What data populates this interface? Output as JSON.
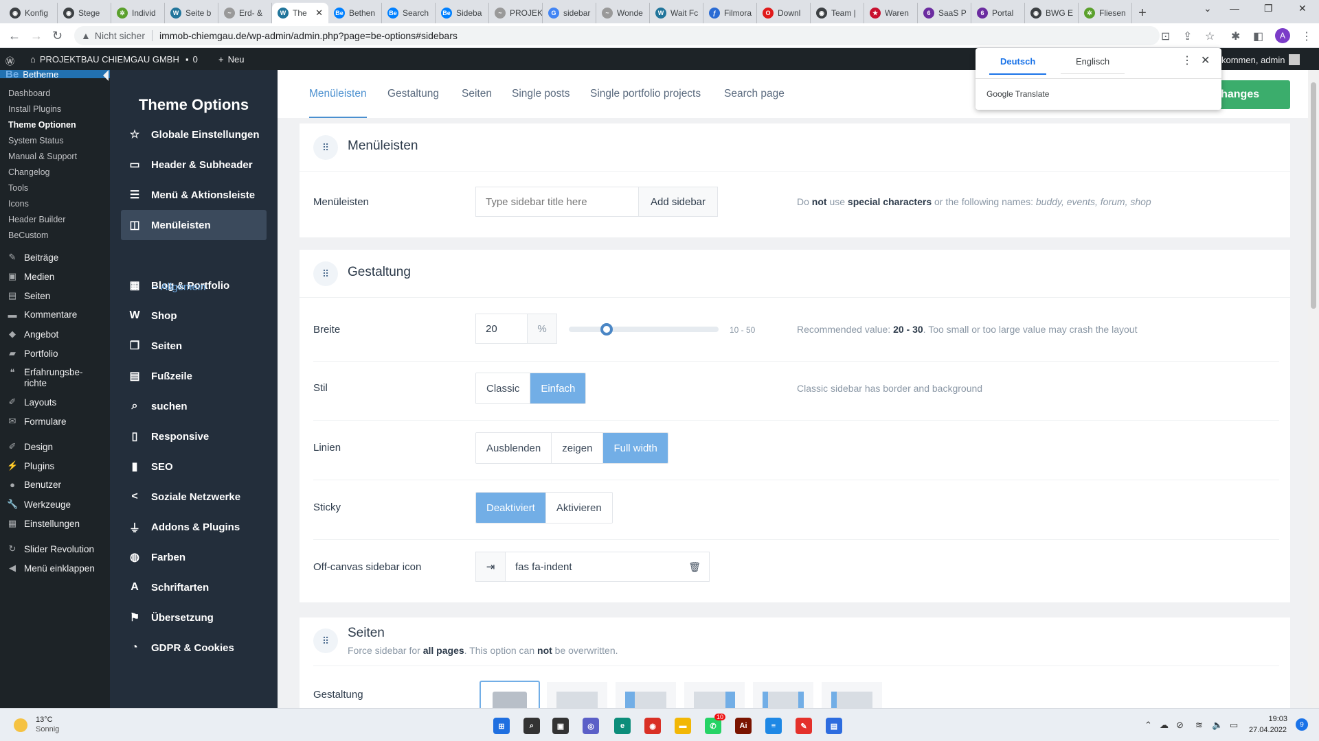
{
  "browser": {
    "tabs": [
      {
        "label": "Konfig",
        "icon": "chrome-icon"
      },
      {
        "label": "Stege",
        "icon": "chrome-icon"
      },
      {
        "label": "Individ",
        "icon": "leaf-icon"
      },
      {
        "label": "Seite b",
        "icon": "wordpress-icon"
      },
      {
        "label": "Erd- &",
        "icon": "wave-icon"
      },
      {
        "label": "The",
        "icon": "wordpress-icon",
        "active": true
      },
      {
        "label": "Bethen",
        "icon": "be-icon"
      },
      {
        "label": "Search",
        "icon": "be-icon"
      },
      {
        "label": "Sideba",
        "icon": "be-icon"
      },
      {
        "label": "PROJEK",
        "icon": "wave-icon"
      },
      {
        "label": "sidebar",
        "icon": "google-icon"
      },
      {
        "label": "Wonde",
        "icon": "wave-icon"
      },
      {
        "label": "Wait Fc",
        "icon": "wordpress-icon"
      },
      {
        "label": "Filmora",
        "icon": "filmora-icon"
      },
      {
        "label": "Downl",
        "icon": "opera-icon"
      },
      {
        "label": "Team |",
        "icon": "chrome-icon"
      },
      {
        "label": "Waren",
        "icon": "star-icon"
      },
      {
        "label": "SaaS P",
        "icon": "six-icon"
      },
      {
        "label": "Portal",
        "icon": "six-icon"
      },
      {
        "label": "BWG E",
        "icon": "chrome-icon"
      },
      {
        "label": "Fliesen",
        "icon": "leaf-icon"
      }
    ],
    "security_warning": "Nicht sicher",
    "url": "immob-chiemgau.de/wp-admin/admin.php?page=be-options#sidebars",
    "avatar_letter": "A"
  },
  "admin_bar": {
    "site_name": "PROJEKTBAU CHIEMGAU GMBH",
    "comments_count": "0",
    "new_label": "Neu",
    "greeting": "kommen, admin"
  },
  "translate_popup": {
    "lang_active": "Deutsch",
    "lang_other": "Englisch",
    "brand": "Google Translate"
  },
  "wp_menu": {
    "betheme_label": "Betheme",
    "submenu": [
      "Dashboard",
      "Install Plugins",
      "Theme Optionen",
      "System Status",
      "Manual & Support",
      "Changelog",
      "Tools",
      "Icons",
      "Header Builder",
      "BeCustom"
    ],
    "items": [
      {
        "label": "Beiträge",
        "icon": "pin-icon"
      },
      {
        "label": "Medien",
        "icon": "media-icon"
      },
      {
        "label": "Seiten",
        "icon": "pages-icon"
      },
      {
        "label": "Kommentare",
        "icon": "comment-icon"
      },
      {
        "label": "Angebot",
        "icon": "offer-icon"
      },
      {
        "label": "Portfolio",
        "icon": "portfolio-icon"
      },
      {
        "label": "Erfahrungsbe-",
        "label2": "richte",
        "icon": "quote-icon"
      },
      {
        "label": "Layouts",
        "icon": "brush-icon"
      },
      {
        "label": "Formulare",
        "icon": "mail-icon"
      },
      {
        "label": "Design",
        "icon": "brush-icon"
      },
      {
        "label": "Plugins",
        "icon": "plugin-icon"
      },
      {
        "label": "Benutzer",
        "icon": "user-icon"
      },
      {
        "label": "Werkzeuge",
        "icon": "wrench-icon"
      },
      {
        "label": "Einstellungen",
        "icon": "settings-icon"
      },
      {
        "label": "Slider Revolution",
        "icon": "refresh-icon"
      },
      {
        "label": "Menü einklappen",
        "icon": "collapse-icon"
      }
    ]
  },
  "theme_sidebar": {
    "title": "Theme Options",
    "items": [
      {
        "label": "Globale Einstellungen",
        "icon": "star-icon"
      },
      {
        "label": "Header & Subheader",
        "icon": "header-icon"
      },
      {
        "label": "Menü & Aktionsleiste",
        "icon": "menu-icon"
      },
      {
        "label": "Menüleisten",
        "icon": "sidebar-icon",
        "current": true
      },
      {
        "label": "Blog & Portfolio",
        "icon": "grid-icon"
      },
      {
        "label": "Shop",
        "icon": "woo-icon"
      },
      {
        "label": "Seiten",
        "icon": "pages-icon"
      },
      {
        "label": "Fußzeile",
        "icon": "footer-icon"
      },
      {
        "label": "suchen",
        "icon": "search-icon"
      },
      {
        "label": "Responsive",
        "icon": "responsive-icon"
      },
      {
        "label": "SEO",
        "icon": "chart-icon"
      },
      {
        "label": "Soziale Netzwerke",
        "icon": "share-icon"
      },
      {
        "label": "Addons & Plugins",
        "icon": "plug-icon"
      },
      {
        "label": "Farben",
        "icon": "palette-icon"
      },
      {
        "label": "Schriftarten",
        "icon": "font-icon"
      },
      {
        "label": "Übersetzung",
        "icon": "flag-icon"
      },
      {
        "label": "GDPR & Cookies",
        "icon": "cookie-icon"
      }
    ],
    "sub_current": "– Allgemein"
  },
  "tabs": [
    "Menüleisten",
    "Gestaltung",
    "Seiten",
    "Single posts",
    "Single portfolio projects",
    "Search page"
  ],
  "save_label": "e changes",
  "section_menu": {
    "title": "Menüleisten",
    "row_label": "Menüleisten",
    "placeholder": "Type sidebar title here",
    "add_btn": "Add sidebar",
    "hint": {
      "pre": "Do ",
      "b1": "not",
      "mid1": " use ",
      "b2": "special characters",
      "mid2": " or the following names: ",
      "names": "buddy, events, forum, shop"
    }
  },
  "section_design": {
    "title": "Gestaltung",
    "width": {
      "label": "Breite",
      "value": "20",
      "unit": "%",
      "range": "10 - 50",
      "slider_fraction": 0.25,
      "hint_pre": "Recommended value: ",
      "hint_b": "20 - 30",
      "hint_post": ". Too small or too large value may crash the layout"
    },
    "style": {
      "label": "Stil",
      "options": [
        "Classic",
        "Einfach"
      ],
      "selected": "Einfach",
      "hint": "Classic sidebar has border and background"
    },
    "lines": {
      "label": "Linien",
      "options": [
        "Ausblenden",
        "zeigen",
        "Full width"
      ],
      "selected": "Full width"
    },
    "sticky": {
      "label": "Sticky",
      "options": [
        "Deaktiviert",
        "Aktivieren"
      ],
      "selected": "Deaktiviert"
    },
    "icon": {
      "label": "Off-canvas sidebar icon",
      "value": "fas fa-indent"
    }
  },
  "section_pages": {
    "title": "Seiten",
    "sub_pre": "Force sidebar for ",
    "sub_b1": "all pages",
    "sub_mid": ". This option can ",
    "sub_b2": "not",
    "sub_post": " be overwritten.",
    "row_label": "Gestaltung"
  },
  "taskbar": {
    "weather_temp": "13°C",
    "weather_text": "Sonnig",
    "time": "19:03",
    "date": "27.04.2022",
    "notif_count": "9",
    "whatsapp_badge": "10"
  },
  "colors": {
    "accent": "#72aee6",
    "save": "#3bad6c",
    "wp_dark": "#1d2327",
    "sidebar": "#232e3b"
  }
}
